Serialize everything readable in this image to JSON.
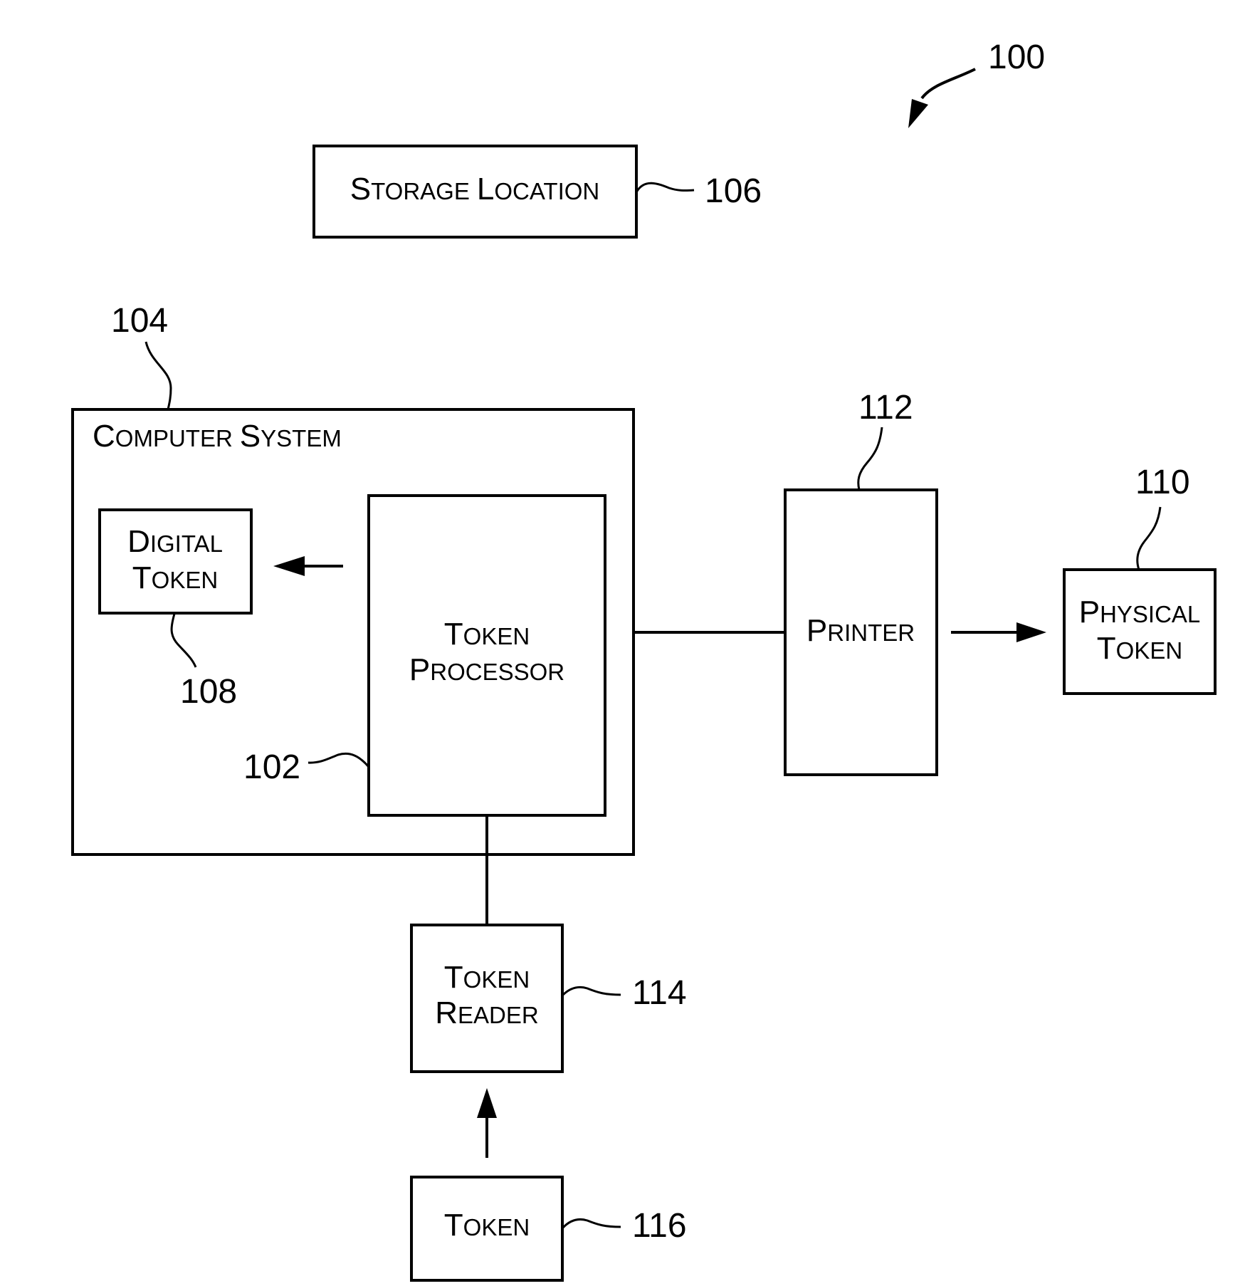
{
  "figure": {
    "reference": "100"
  },
  "blocks": {
    "storage_location": {
      "first": [
        "S",
        "TORAGE"
      ],
      "second": [
        "L",
        "OCATION"
      ],
      "ref": "106"
    },
    "computer_system": {
      "first": [
        "C",
        "OMPUTER"
      ],
      "second": [
        "S",
        "YSTEM"
      ],
      "ref": "104"
    },
    "digital_token": {
      "line1": [
        "D",
        "IGITAL"
      ],
      "line2": [
        "T",
        "OKEN"
      ],
      "ref": "108"
    },
    "token_processor": {
      "line1": [
        "T",
        "OKEN"
      ],
      "line2": [
        "P",
        "ROCESSOR"
      ],
      "ref": "102"
    },
    "printer": {
      "line1": [
        "P",
        "RINTER"
      ],
      "ref": "112"
    },
    "physical_token": {
      "line1": [
        "P",
        "HYSICAL"
      ],
      "line2": [
        "T",
        "OKEN"
      ],
      "ref": "110"
    },
    "token_reader": {
      "line1": [
        "T",
        "OKEN"
      ],
      "line2": [
        "R",
        "EADER"
      ],
      "ref": "114"
    },
    "token": {
      "line1": [
        "T",
        "OKEN"
      ],
      "ref": "116"
    }
  },
  "connections": [
    {
      "from": "token_processor",
      "to": "digital_token",
      "type": "arrow"
    },
    {
      "from": "computer_system",
      "to": "printer",
      "type": "line"
    },
    {
      "from": "printer",
      "to": "physical_token",
      "type": "arrow"
    },
    {
      "from": "token_processor",
      "to": "token_reader",
      "type": "line"
    },
    {
      "from": "token",
      "to": "token_reader",
      "type": "arrow"
    }
  ]
}
